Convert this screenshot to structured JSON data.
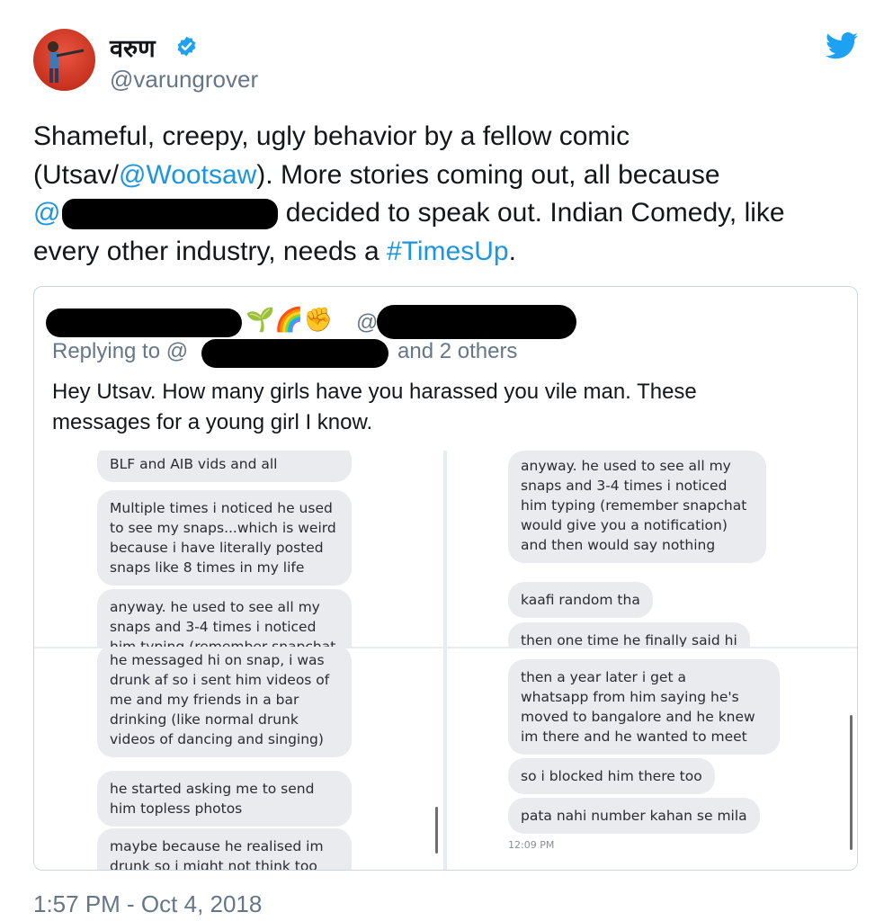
{
  "author": {
    "display_name": "वरुण",
    "handle": "@varungrover",
    "verified": true,
    "avatar_icon": "avatar"
  },
  "tweet": {
    "text_line1": "Shameful, creepy, ugly behavior by a fellow comic",
    "text_line2_a": "(Utsav/",
    "mention_wootsaw": "@Wootsaw",
    "text_line2_b": "). More stories coming out, all because",
    "mention_redacted_prefix": "@",
    "text_line3_b": " decided to speak out. Indian Comedy, like",
    "text_line4_a": "every other industry, needs a ",
    "hashtag": "#TimesUp",
    "text_line4_b": ".",
    "timestamp": "1:57 PM - Oct 4, 2018"
  },
  "quoted_tweet": {
    "emoji": "🌱🌈✊",
    "at_symbol": "@",
    "replying_to_label": "Replying to @",
    "replying_to_rest": "and 2 others",
    "body_line1": "Hey Utsav. How many girls have you harassed you vile man. These",
    "body_line2": "messages for a young girl I know."
  },
  "screenshots": {
    "panel1": [
      "BLF and AIB vids and all",
      "Multiple times i noticed he used",
      "to see my snaps...which is weird",
      "because i have literally posted",
      "snaps like 8 times in my life",
      "anyway. he used to see all my",
      "snaps and 3-4 times i noticed",
      "him typing (remember snapchat"
    ],
    "panel2": [
      "anyway. he used to see all my",
      "snaps and 3-4 times i noticed",
      "him typing (remember snapchat",
      "would give you a notification)",
      "and then would say nothing",
      "kaafi random tha",
      "then one time he finally said hi"
    ],
    "panel3": [
      "he messaged hi on snap, i was",
      "drunk af so i sent him videos of",
      "me and my friends in a bar",
      "drinking (like normal drunk",
      "videos of dancing and singing)",
      "he started asking me to send",
      "him topless photos",
      "maybe because he realised im",
      "drunk so i might not think too"
    ],
    "panel4": [
      "then a year later i get a",
      "whatsapp from him saying he's",
      "moved to bangalore and he knew",
      "im there and he wanted to meet",
      "so i blocked him there too",
      "pata nahi number kahan se mila"
    ],
    "panel4_time": "12:09 PM"
  },
  "colors": {
    "link": "#1b95e0",
    "secondary_text": "#657786",
    "bubble": "#e9ebef",
    "twitter_blue": "#1da1f2"
  }
}
